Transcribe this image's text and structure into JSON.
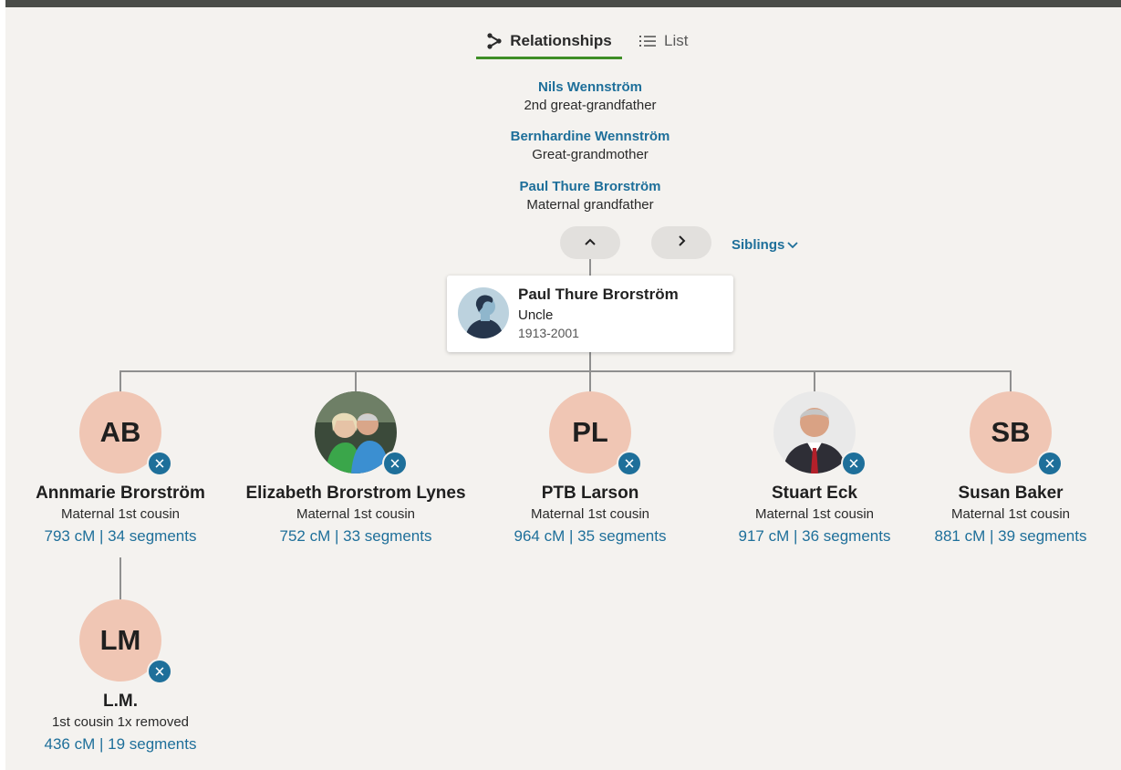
{
  "tabs": {
    "relationships": "Relationships",
    "list": "List"
  },
  "ancestors": [
    {
      "name": "Nils Wennström",
      "relation": "2nd great-grandfather"
    },
    {
      "name": "Bernhardine Wennström",
      "relation": "Great-grandmother"
    },
    {
      "name": "Paul Thure Brorström",
      "relation": "Maternal grandfather"
    }
  ],
  "nav": {
    "siblings_label": "Siblings"
  },
  "focus": {
    "name": "Paul Thure Brorström",
    "relation": "Uncle",
    "years": "1913-2001"
  },
  "children": [
    {
      "initials": "AB",
      "name": "Annmarie Brorström",
      "relation": "Maternal 1st cousin",
      "dna": "793 cM | 34 segments"
    },
    {
      "initials": "",
      "name": "Elizabeth Brorstrom Lynes",
      "relation": "Maternal 1st cousin",
      "dna": "752 cM | 33 segments"
    },
    {
      "initials": "PL",
      "name": "PTB Larson",
      "relation": "Maternal 1st cousin",
      "dna": "964 cM | 35 segments"
    },
    {
      "initials": "",
      "name": "Stuart Eck",
      "relation": "Maternal 1st cousin",
      "dna": "917 cM | 36 segments"
    },
    {
      "initials": "SB",
      "name": "Susan Baker",
      "relation": "Maternal 1st cousin",
      "dna": "881 cM | 39 segments"
    }
  ],
  "grandchild": {
    "initials": "LM",
    "name": "L.M.",
    "relation": "1st cousin 1x removed",
    "dna": "436 cM | 19 segments"
  },
  "colors": {
    "link": "#1e6f9a",
    "tab_underline": "#3e8e26",
    "avatar_bg": "#f0c6b4",
    "dna_badge": "#1e6f9a"
  }
}
